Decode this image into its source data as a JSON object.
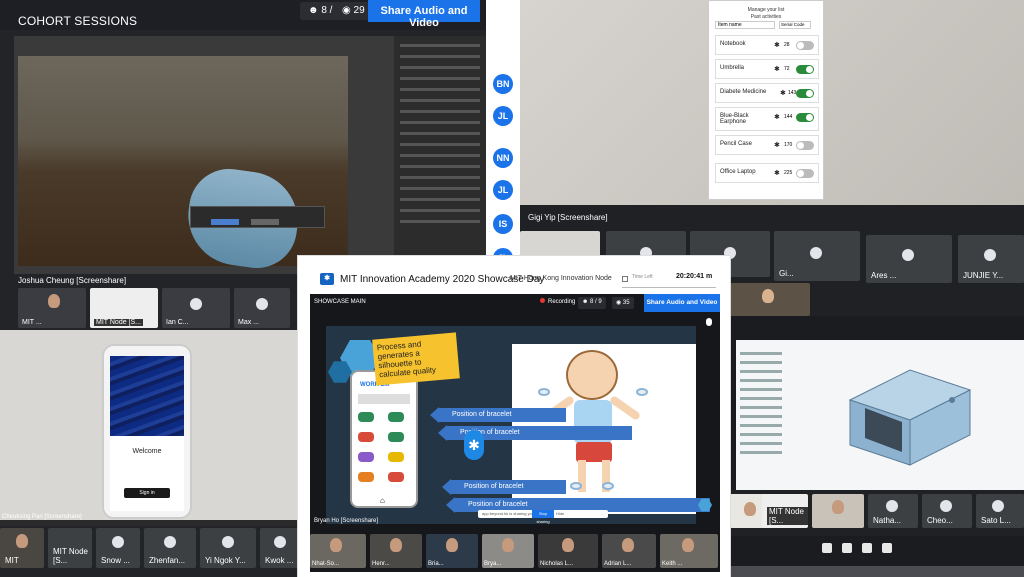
{
  "top_left": {
    "title": "COHORT SESSIONS",
    "participants_count": "8 / 9",
    "viewers_count": "29",
    "share_button": "Share Audio and Video",
    "screenshare_label": "Joshua Cheung [Screenshare]",
    "avatars": [
      "BN",
      "JL",
      "NN",
      "JL",
      "IS",
      "JL"
    ],
    "thumbs": [
      "MIT ...",
      "MIT Node [S...",
      "Ian C...",
      "Max ..."
    ]
  },
  "top_right": {
    "screenshare_label": "Gigi Yip [Screenshare]",
    "items": [
      {
        "label": "Notebook",
        "value": "28",
        "on": false
      },
      {
        "label": "Umbrella",
        "value": "72",
        "on": true
      },
      {
        "label": "Diabete Medicine",
        "value": "143",
        "on": true
      },
      {
        "label": "Blue-Black Earphone",
        "value": "144",
        "on": true
      },
      {
        "label": "Pencil Case",
        "value": "170",
        "on": false
      },
      {
        "label": "Office Laptop",
        "value": "225",
        "on": false
      }
    ],
    "app_header": "Manage your list",
    "app_sub": "Past activities",
    "app_input": "Item name",
    "app_serial": "Serial Code",
    "tiles": [
      "Gi...",
      "Ares ...",
      "JUNJIE Y..."
    ]
  },
  "bottom_left": {
    "welcome": "Welcome",
    "signin": "Sign in",
    "screenshare_label": "Cheuksing Pan [Screenshare]",
    "thumbs": [
      "MIT",
      "MIT Node [S...",
      "Snow ...",
      "Zhenfan...",
      "Yi Ngok Y...",
      "Kwok ..."
    ]
  },
  "bottom_right": {
    "thumbs": [
      "MIT Node [S...",
      "Natha...",
      "Cheo...",
      "Sato L..."
    ]
  },
  "center": {
    "app_title": "MIT Innovation Academy 2020 Showcase Day",
    "node": "MIT Hong Kong Innovation Node",
    "time_label": "Time Left",
    "time_value": "20:20:41 m",
    "showcase_main": "SHOWCASE MAIN",
    "recording": "Recording",
    "participants_count": "8 / 9",
    "viewers_count": "35",
    "share_button": "Share Audio and Video",
    "note_text": "Process and generates a silhouette to calculate quality",
    "app_logo": "WORK'EM",
    "bracelet_1": "Position of bracelet",
    "bracelet_2": "Position of bracelet",
    "bracelet_3": "Position of bracelet",
    "bracelet_4": "Position of bracelet",
    "viewing_text": "app.beyond.hk is sharing your screen",
    "stop_sharing": "Stop sharing",
    "hide": "Hide",
    "screenshare_label": "Bryan Ho [Screenshare]",
    "gallery": [
      "Nhat-So...",
      "Henr...",
      "Bria...",
      "Brya...",
      "Nicholas L...",
      "Adrian L...",
      "Keith ..."
    ]
  },
  "colors": {
    "accent_blue": "#1a73e8",
    "recording_red": "#e53935",
    "toggle_green": "#2a8c3a",
    "sticky_yellow": "#f6c22d"
  }
}
